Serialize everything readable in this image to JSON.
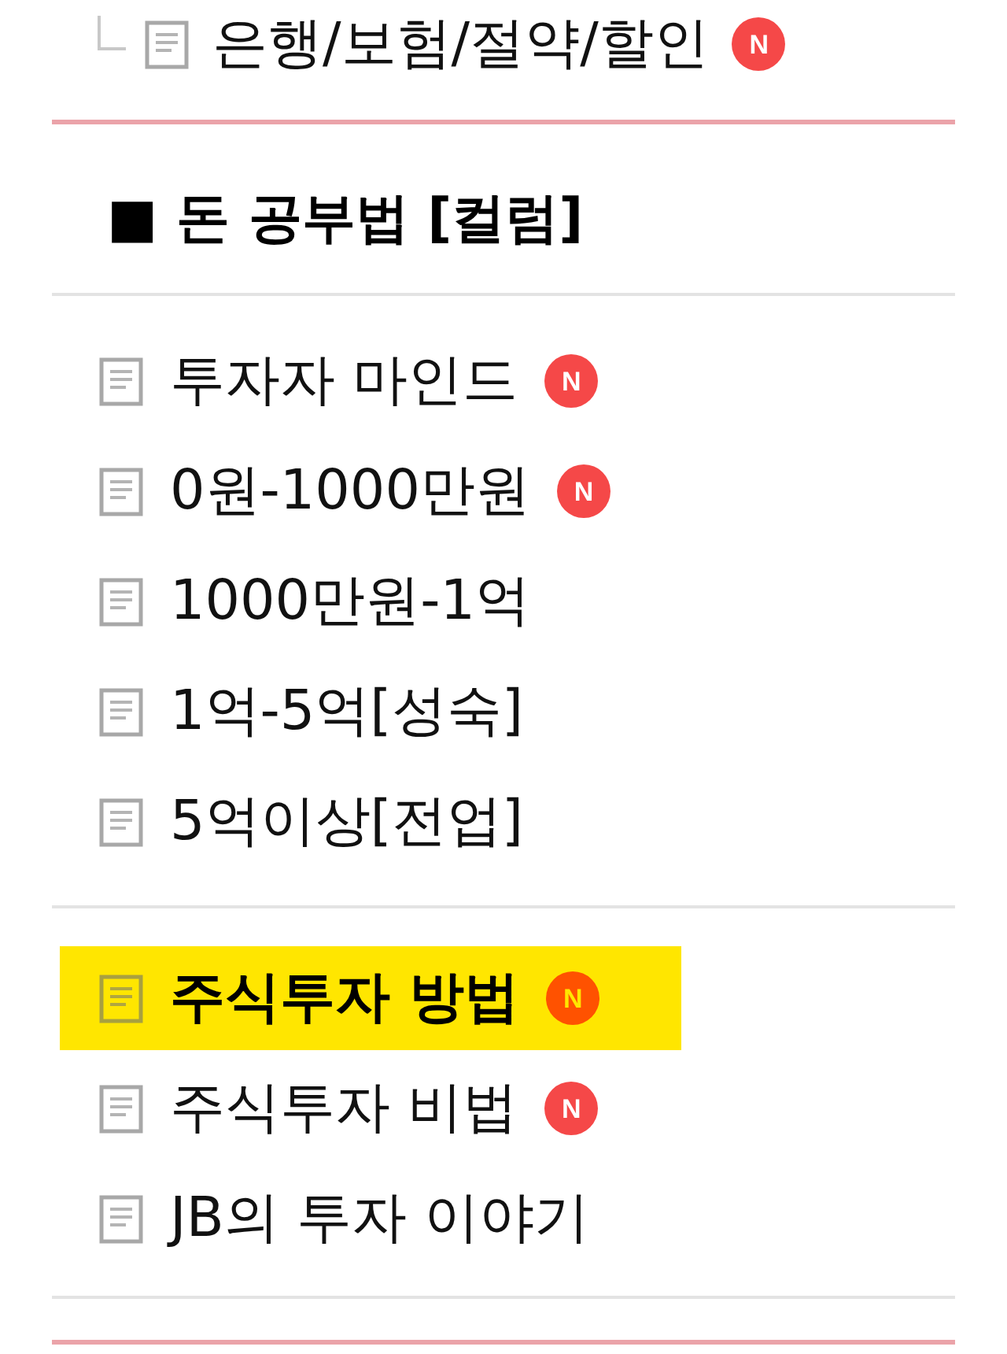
{
  "previous_category": {
    "children": [
      {
        "label": "은행/보험/절약/할인",
        "badge": "N",
        "selected": false
      }
    ]
  },
  "section": {
    "heading": "■ 돈 공부법 [컬럼]",
    "groups": [
      {
        "items": [
          {
            "label": "투자자 마인드",
            "badge": "N",
            "selected": false
          },
          {
            "label": "0원-1000만원",
            "badge": "N",
            "selected": false
          },
          {
            "label": "1000만원-1억",
            "selected": false
          },
          {
            "label": "1억-5억[성숙]",
            "selected": false
          },
          {
            "label": "5억이상[전업]",
            "selected": false
          }
        ]
      },
      {
        "items": [
          {
            "label": "주식투자 방법",
            "badge": "N",
            "selected": true
          },
          {
            "label": "주식투자 비법",
            "badge": "N",
            "selected": false
          },
          {
            "label": "JB의 투자 이야기",
            "selected": false
          }
        ]
      }
    ]
  }
}
